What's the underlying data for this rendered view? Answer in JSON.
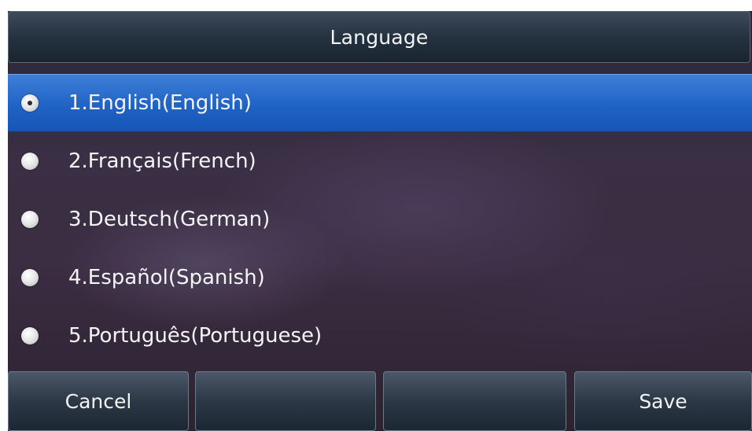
{
  "title": "Language",
  "languages": [
    {
      "label": "1.English(English)",
      "selected": true
    },
    {
      "label": "2.Français(French)",
      "selected": false
    },
    {
      "label": "3.Deutsch(German)",
      "selected": false
    },
    {
      "label": "4.Español(Spanish)",
      "selected": false
    },
    {
      "label": "5.Português(Portuguese)",
      "selected": false
    }
  ],
  "softkeys": {
    "key1": "Cancel",
    "key2": "",
    "key3": "",
    "key4": "Save"
  },
  "colors": {
    "selection_highlight": "#1f63c6",
    "title_bar": "#253240",
    "text": "#f4f4f6"
  }
}
